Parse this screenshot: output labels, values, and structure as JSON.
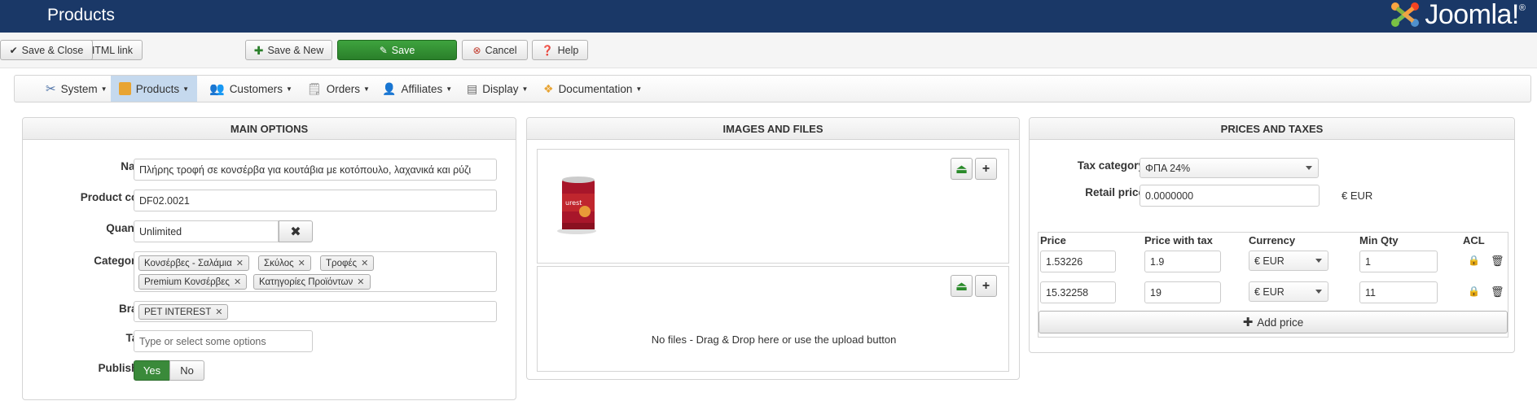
{
  "header": {
    "title": "Products",
    "logo_text": "Joomla!",
    "logo_reg": "®"
  },
  "toolbar": {
    "add_to_cart": "Add to cart HTML link",
    "save_close": "Save & Close",
    "save_new": "Save & New",
    "save": "Save",
    "cancel": "Cancel",
    "help": "Help"
  },
  "menu": {
    "system": "System",
    "products": "Products",
    "customers": "Customers",
    "orders": "Orders",
    "affiliates": "Affiliates",
    "display": "Display",
    "documentation": "Documentation"
  },
  "main_options": {
    "heading": "MAIN OPTIONS",
    "name_label": "Name",
    "name_value": "Πλήρης τροφή σε κονσέρβα για κουτάβια με κοτόπουλο, λαχανικά και ρύζι",
    "code_label": "Product code",
    "code_value": "DF02.0021",
    "quantity_label": "Quantity",
    "quantity_value": "Unlimited",
    "categories_label": "Categories",
    "categories": [
      "Κονσέρβες - Σαλάμια",
      "Σκύλος",
      "Τροφές",
      "Premium Κονσέρβες",
      "Κατηγορίες Προϊόντων"
    ],
    "brand_label": "Brand",
    "brand_value": "PET INTEREST",
    "tags_label": "Tags",
    "tags_placeholder": "Type or select some options",
    "published_label": "Published",
    "yes": "Yes",
    "no": "No"
  },
  "images": {
    "heading": "IMAGES AND FILES",
    "no_files": "No files - Drag & Drop here or use the upload button"
  },
  "prices": {
    "heading": "PRICES AND TAXES",
    "tax_label": "Tax category",
    "tax_value": "ΦΠΑ 24%",
    "retail_label": "Retail price",
    "retail_value": "0.0000000",
    "retail_currency": "€ EUR",
    "col_price": "Price",
    "col_price_tax": "Price with tax",
    "col_currency": "Currency",
    "col_min_qty": "Min Qty",
    "col_acl": "ACL",
    "rows": [
      {
        "price": "1.53226",
        "price_tax": "1.9",
        "currency": "€ EUR",
        "min_qty": "1"
      },
      {
        "price": "15.32258",
        "price_tax": "19",
        "currency": "€ EUR",
        "min_qty": "11"
      }
    ],
    "add_price": "Add price"
  },
  "colors": {
    "header_bg": "#1a3867",
    "save_green": "#2f8f2f",
    "active_menu": "#c5d9ee"
  }
}
